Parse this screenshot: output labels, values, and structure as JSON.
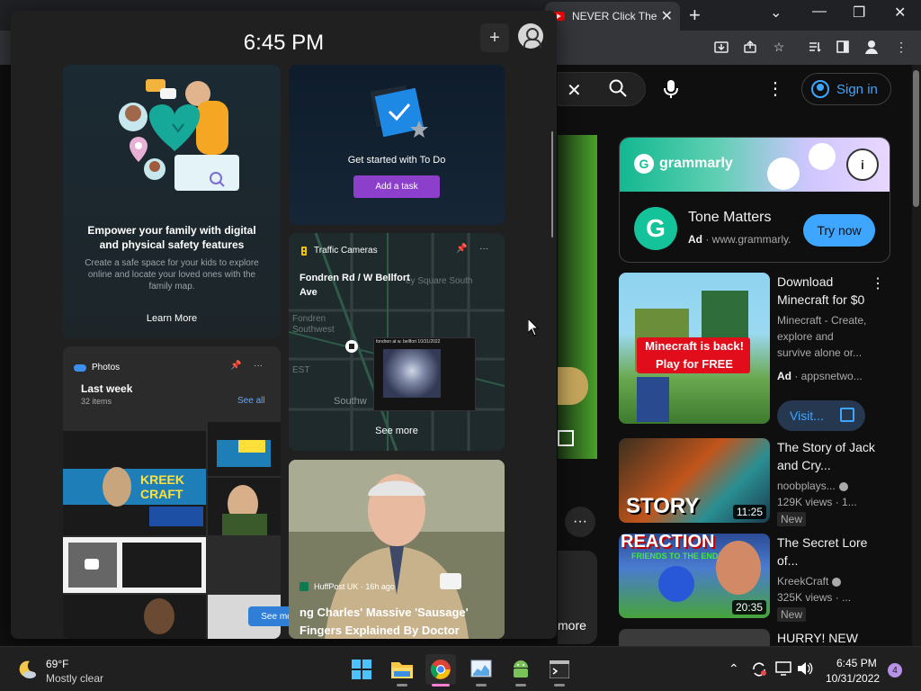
{
  "browser": {
    "tab_title": "NEVER Click The",
    "tab_close": "✕",
    "new_tab": "+",
    "controls": {
      "minimize": "—",
      "restore": "❐",
      "close": "✕"
    }
  },
  "youtube": {
    "clear_icon": "✕",
    "signin_label": "Sign in",
    "more_label": "more",
    "ad": {
      "banner_brand": "grammarly",
      "title": "Tone Matters",
      "ad_label": "Ad",
      "domain": "www.grammarly.",
      "cta": "Try now",
      "info_icon": "i"
    },
    "recommendations": [
      {
        "title": "Download Minecraft for $0",
        "meta": [
          "Minecraft - Create,",
          "explore and",
          "survive alone or..."
        ],
        "ad_label": "Ad",
        "ad_domain": "appsnetwo...",
        "visit_label": "Visit...",
        "thumb_line1": "Minecraft is back!",
        "thumb_line2": "Play for FREE"
      },
      {
        "title": "The Story of Jack and Cry...",
        "channel": "noobplays...",
        "views": "129K views · 1...",
        "duration": "11:25",
        "badge": "New",
        "thumb_text": "STORY"
      },
      {
        "title": "The Secret Lore of...",
        "channel": "KreekCraft",
        "views": "325K views · ...",
        "duration": "20:35",
        "badge": "New",
        "thumb_text": "REACTION",
        "thumb_sub": "FRIENDS TO THE END!"
      },
      {
        "title": "HURRY! NEW"
      }
    ]
  },
  "widgets": {
    "time": "6:45 PM",
    "add_icon": "+",
    "family": {
      "title": "Empower your family with digital and physical safety features",
      "description": "Create a safe space for your kids to explore online and locate your loved ones with the family map.",
      "link": "Learn More"
    },
    "todo": {
      "title": "Get started with To Do",
      "button": "Add a task"
    },
    "traffic": {
      "header": "Traffic Cameras",
      "location": "Fondren Rd / W Bellfort Ave",
      "map_labels": [
        "ey Square South",
        "Fondren",
        "Southwest",
        "EST",
        "Southw"
      ],
      "cam_caption": "fondren at w. bellfort 10/31/2022",
      "see_more": "See more",
      "menu": "···"
    },
    "photos": {
      "header": "Photos",
      "period": "Last week",
      "count": "32 items",
      "see_all": "See all",
      "menu": "···",
      "thumb_text": "KREEK CRAFT",
      "see_more": "See more ›"
    },
    "news": {
      "source": "HuffPost UK · 16h ago",
      "title": "ng Charles' Massive 'Sausage' Fingers Explained By Doctor"
    }
  },
  "taskbar": {
    "temperature": "69°F",
    "condition": "Mostly clear",
    "time": "6:45 PM",
    "date": "10/31/2022",
    "notifications": "4",
    "apps": [
      "start-icon",
      "file-explorer-icon",
      "chrome-icon",
      "resource-monitor-icon",
      "android-studio-icon",
      "terminal-icon"
    ]
  }
}
